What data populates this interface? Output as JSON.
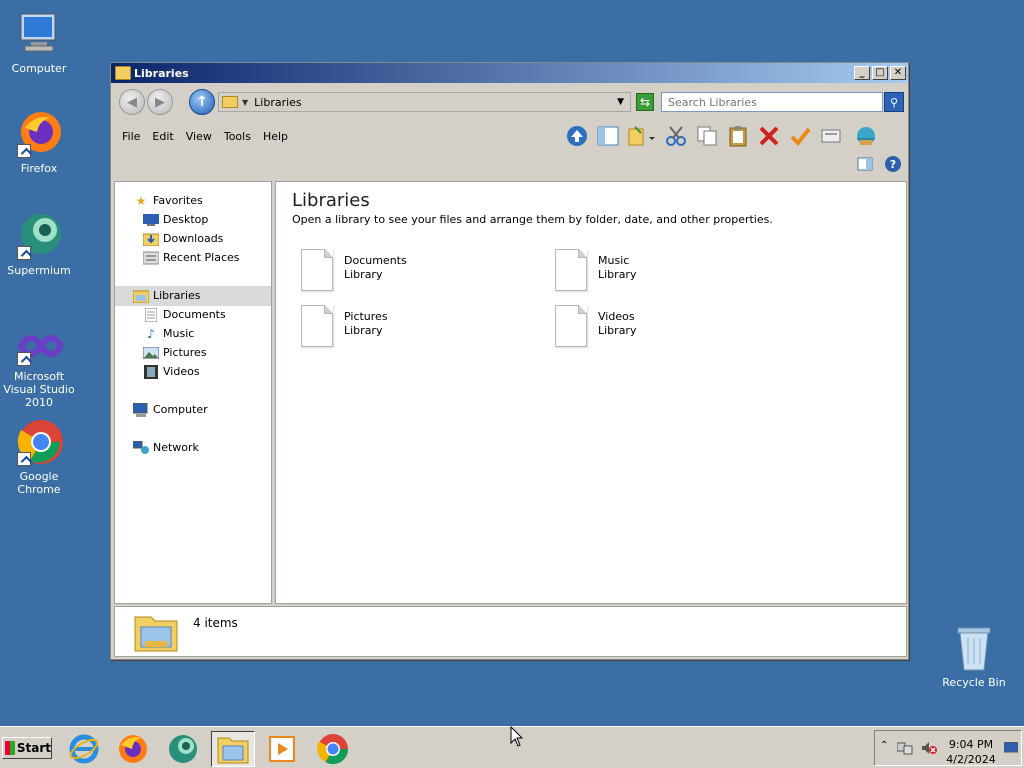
{
  "desktop": {
    "icons": [
      {
        "label": "Computer"
      },
      {
        "label": "Firefox"
      },
      {
        "label": "Supermium"
      },
      {
        "label": "Microsoft Visual Studio 2010"
      },
      {
        "label": "Google Chrome"
      },
      {
        "label": "Recycle Bin"
      }
    ]
  },
  "window": {
    "title": "Libraries",
    "controls": {
      "minimize": "_",
      "maximize": "□",
      "close": "✕"
    },
    "address": {
      "path": "Libraries"
    },
    "search": {
      "placeholder": "Search Libraries"
    },
    "menu": [
      "File",
      "Edit",
      "View",
      "Tools",
      "Help"
    ],
    "nav": {
      "favorites": "Favorites",
      "desktop": "Desktop",
      "downloads": "Downloads",
      "recent": "Recent Places",
      "libraries": "Libraries",
      "documents": "Documents",
      "music": "Music",
      "pictures": "Pictures",
      "videos": "Videos",
      "computer": "Computer",
      "network": "Network"
    },
    "main": {
      "title": "Libraries",
      "subtitle": "Open a library to see your files and arrange them by folder, date, and other properties.",
      "items": [
        {
          "name": "Documents",
          "type": "Library"
        },
        {
          "name": "Music",
          "type": "Library"
        },
        {
          "name": "Pictures",
          "type": "Library"
        },
        {
          "name": "Videos",
          "type": "Library"
        }
      ]
    },
    "status": {
      "count": "4 items"
    }
  },
  "taskbar": {
    "start_label": "Start",
    "clock": {
      "time": "9:04 PM",
      "date": "4/2/2024"
    }
  },
  "colors": {
    "desktop": "#3a6ea5",
    "titlebar_start": "#0a246a",
    "titlebar_end": "#a6caf0"
  }
}
